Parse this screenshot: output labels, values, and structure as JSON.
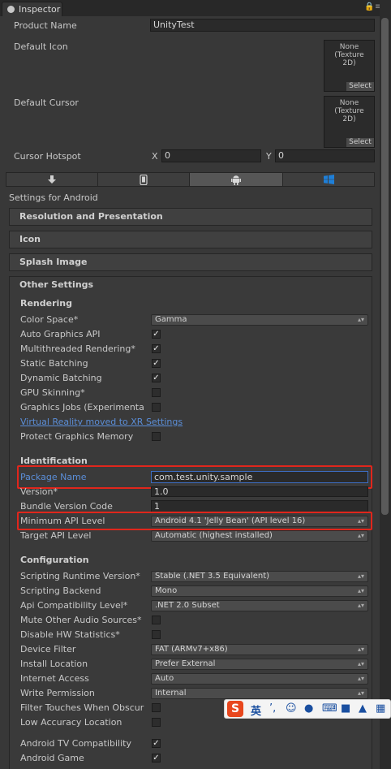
{
  "window": {
    "tab_title": "Inspector",
    "lock_icon": "lock-icon",
    "menu_icon": "menu-icon"
  },
  "player": {
    "product_name_label": "Product Name",
    "product_name_value": "UnityTest",
    "default_icon_label": "Default Icon",
    "default_cursor_label": "Default Cursor",
    "texture_none_line1": "None",
    "texture_none_line2": "(Texture",
    "texture_none_line3": "2D)",
    "select_label": "Select",
    "cursor_hotspot_label": "Cursor Hotspot",
    "hotspot_x_label": "X",
    "hotspot_x_value": "0",
    "hotspot_y_label": "Y",
    "hotspot_y_value": "0"
  },
  "platforms": {
    "icons": [
      "download-icon",
      "phone-icon",
      "android-icon",
      "windows-icon"
    ],
    "active_index": 2,
    "settings_for": "Settings for Android"
  },
  "sections": {
    "resolution": "Resolution and Presentation",
    "icon": "Icon",
    "splash": "Splash Image",
    "other": "Other Settings"
  },
  "rendering": {
    "header": "Rendering",
    "color_space_label": "Color Space*",
    "color_space_value": "Gamma",
    "auto_graphics_label": "Auto Graphics API",
    "multithreaded_label": "Multithreaded Rendering*",
    "static_batching_label": "Static Batching",
    "dynamic_batching_label": "Dynamic Batching",
    "gpu_skinning_label": "GPU Skinning*",
    "graphics_jobs_label": "Graphics Jobs (Experimenta",
    "vr_link": "Virtual Reality moved to XR Settings",
    "protect_memory_label": "Protect Graphics Memory"
  },
  "identification": {
    "header": "Identification",
    "package_name_label": "Package Name",
    "package_name_value": "com.test.unity.sample",
    "version_label": "Version*",
    "version_value": "1.0",
    "bundle_code_label": "Bundle Version Code",
    "bundle_code_value": "1",
    "min_api_label": "Minimum API Level",
    "min_api_value": "Android 4.1 'Jelly Bean' (API level 16)",
    "target_api_label": "Target API Level",
    "target_api_value": "Automatic (highest installed)"
  },
  "configuration": {
    "header": "Configuration",
    "scripting_runtime_label": "Scripting Runtime Version*",
    "scripting_runtime_value": "Stable (.NET 3.5 Equivalent)",
    "scripting_backend_label": "Scripting Backend",
    "scripting_backend_value": "Mono",
    "api_compat_label": "Api Compatibility Level*",
    "api_compat_value": ".NET 2.0 Subset",
    "mute_audio_label": "Mute Other Audio Sources*",
    "disable_hw_label": "Disable HW Statistics*",
    "device_filter_label": "Device Filter",
    "device_filter_value": "FAT (ARMv7+x86)",
    "install_location_label": "Install Location",
    "install_location_value": "Prefer External",
    "internet_access_label": "Internet Access",
    "internet_access_value": "Auto",
    "write_permission_label": "Write Permission",
    "write_permission_value": "Internal",
    "filter_touches_label": "Filter Touches When Obscur",
    "low_accuracy_label": "Low Accuracy Location",
    "android_tv_label": "Android TV Compatibility",
    "android_game_label": "Android Game"
  },
  "ime": {
    "logo": "S",
    "mode": "英"
  },
  "colors": {
    "background": "#383838",
    "highlight": "#e0261c",
    "link": "#5b8ed8"
  }
}
